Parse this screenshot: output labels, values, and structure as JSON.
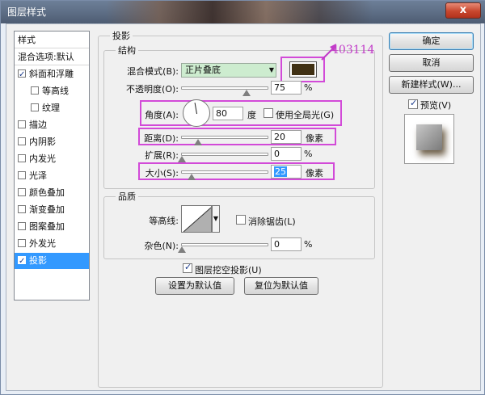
{
  "window": {
    "title": "图层样式",
    "close_label": "x"
  },
  "style_list": {
    "items": [
      {
        "label": "样式",
        "checkbox": false,
        "checked": false,
        "indent": false,
        "selected": false
      },
      {
        "label": "混合选项:默认",
        "checkbox": false,
        "checked": false,
        "indent": false,
        "selected": false
      },
      {
        "label": "斜面和浮雕",
        "checkbox": true,
        "checked": true,
        "indent": false,
        "selected": false
      },
      {
        "label": "等高线",
        "checkbox": true,
        "checked": false,
        "indent": true,
        "selected": false
      },
      {
        "label": "纹理",
        "checkbox": true,
        "checked": false,
        "indent": true,
        "selected": false
      },
      {
        "label": "描边",
        "checkbox": true,
        "checked": false,
        "indent": false,
        "selected": false
      },
      {
        "label": "内阴影",
        "checkbox": true,
        "checked": false,
        "indent": false,
        "selected": false
      },
      {
        "label": "内发光",
        "checkbox": true,
        "checked": false,
        "indent": false,
        "selected": false
      },
      {
        "label": "光泽",
        "checkbox": true,
        "checked": false,
        "indent": false,
        "selected": false
      },
      {
        "label": "颜色叠加",
        "checkbox": true,
        "checked": false,
        "indent": false,
        "selected": false
      },
      {
        "label": "渐变叠加",
        "checkbox": true,
        "checked": false,
        "indent": false,
        "selected": false
      },
      {
        "label": "图案叠加",
        "checkbox": true,
        "checked": false,
        "indent": false,
        "selected": false
      },
      {
        "label": "外发光",
        "checkbox": true,
        "checked": false,
        "indent": false,
        "selected": false
      },
      {
        "label": "投影",
        "checkbox": true,
        "checked": true,
        "indent": false,
        "selected": true
      }
    ]
  },
  "drop_shadow": {
    "section_title": "投影",
    "structure_title": "结构",
    "blend_mode_label": "混合模式(B):",
    "blend_mode_value": "正片叠底",
    "shadow_color": "#403114",
    "annotation": "403114",
    "opacity_label": "不透明度(O):",
    "opacity_value": "75",
    "opacity_unit": "%",
    "opacity_level": 0.75,
    "angle_label": "角度(A):",
    "angle_value": "80",
    "angle_unit": "度",
    "global_light_label": "使用全局光(G)",
    "global_light_checked": false,
    "distance_label": "距离(D):",
    "distance_value": "20",
    "distance_unit": "像素",
    "spread_label": "扩展(R):",
    "spread_value": "0",
    "spread_unit": "%",
    "size_label": "大小(S):",
    "size_value": "25",
    "size_unit": "像素",
    "quality_title": "品质",
    "contour_label": "等高线:",
    "antialias_label": "消除锯齿(L)",
    "antialias_checked": false,
    "noise_label": "杂色(N):",
    "noise_value": "0",
    "noise_unit": "%",
    "knockout_label": "图层挖空投影(U)",
    "knockout_checked": true,
    "set_default_label": "设置为默认值",
    "reset_default_label": "复位为默认值"
  },
  "actions": {
    "ok_label": "确定",
    "cancel_label": "取消",
    "new_style_label": "新建样式(W)...",
    "preview_label": "预览(V)",
    "preview_checked": true
  }
}
